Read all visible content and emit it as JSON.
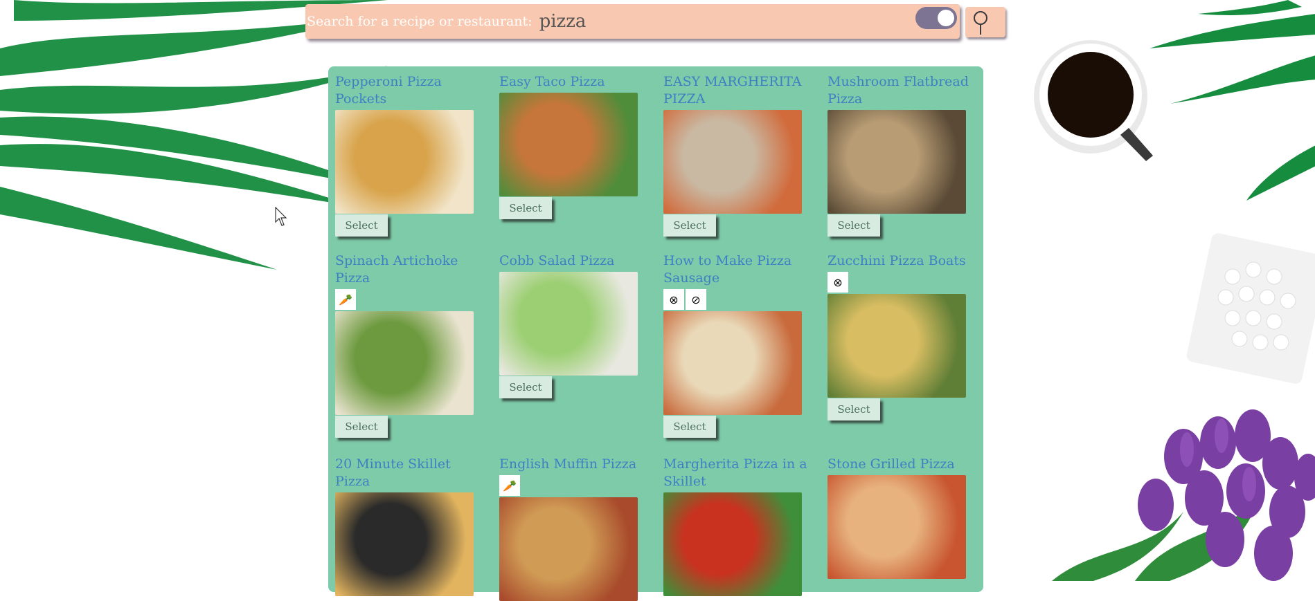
{
  "search": {
    "label": "Search for a recipe or restaurant:",
    "value": "pizza",
    "toggle_on": true,
    "button_icon": "magnifier-icon"
  },
  "colors": {
    "search_bg": "#f8c8b0",
    "panel_bg": "#7ecba9",
    "title_color": "#3f7fc4",
    "select_bg": "#d8ebe1"
  },
  "select_label": "Select",
  "recipes": [
    {
      "title": "Pepperoni Pizza Pockets",
      "badges": []
    },
    {
      "title": "Easy Taco Pizza",
      "badges": []
    },
    {
      "title": "EASY MARGHERITA PIZZA",
      "badges": []
    },
    {
      "title": "Mushroom Flatbread Pizza",
      "badges": []
    },
    {
      "title": "Spinach Artichoke Pizza",
      "badges": [
        "vegetarian-icon"
      ]
    },
    {
      "title": "Cobb Salad Pizza",
      "badges": []
    },
    {
      "title": "How to Make Pizza Sausage",
      "badges": [
        "gluten-free-icon",
        "dairy-free-icon"
      ]
    },
    {
      "title": "Zucchini Pizza Boats",
      "badges": [
        "gluten-free-icon"
      ]
    },
    {
      "title": "20 Minute Skillet Pizza",
      "badges": []
    },
    {
      "title": "English Muffin Pizza",
      "badges": [
        "vegetarian-icon"
      ]
    },
    {
      "title": "Margherita Pizza in a Skillet",
      "badges": []
    },
    {
      "title": "Stone Grilled Pizza",
      "badges": []
    }
  ]
}
